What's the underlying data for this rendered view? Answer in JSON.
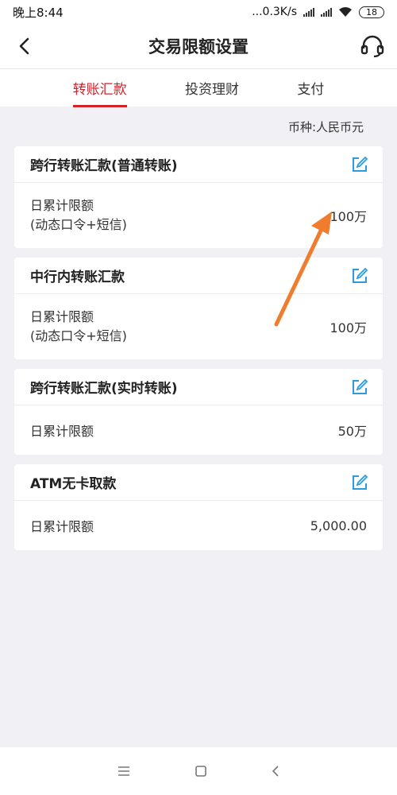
{
  "status": {
    "time": "晚上8:44",
    "speed": "...0.3K/s",
    "battery": "18"
  },
  "nav": {
    "title": "交易限额设置"
  },
  "tabs": [
    {
      "label": "转账汇款",
      "active": true
    },
    {
      "label": "投资理财",
      "active": false
    },
    {
      "label": "支付",
      "active": false
    }
  ],
  "currency": "币种:人民币元",
  "cards": [
    {
      "title": "跨行转账汇款(普通转账)",
      "label": "日累计限额",
      "sublabel": "(动态口令+短信)",
      "value": "100万"
    },
    {
      "title": "中行内转账汇款",
      "label": "日累计限额",
      "sublabel": "(动态口令+短信)",
      "value": "100万"
    },
    {
      "title": "跨行转账汇款(实时转账)",
      "label": "日累计限额",
      "value": "50万"
    },
    {
      "title": "ATM无卡取款",
      "label": "日累计限额",
      "value": "5,000.00"
    }
  ],
  "colors": {
    "accent": "#d0232b",
    "edit_icon": "#2e9be0",
    "annotation_arrow": "#f07c2e"
  }
}
